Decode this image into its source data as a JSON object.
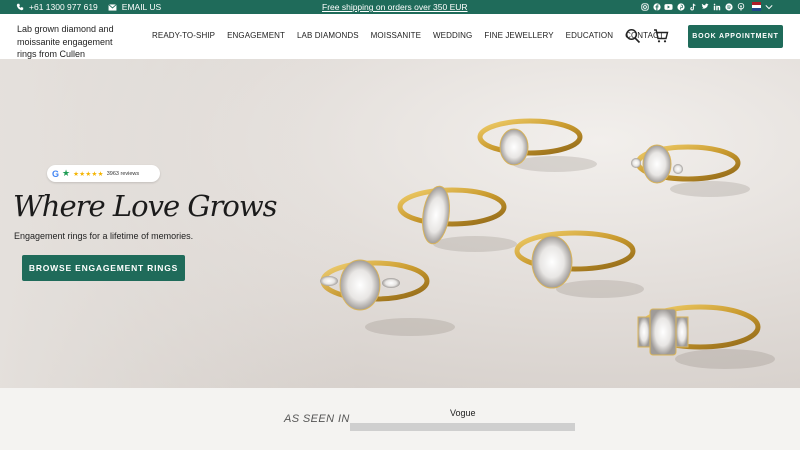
{
  "topbar": {
    "phone": "+61 1300 977 619",
    "email": "EMAIL US",
    "promo": "Free shipping on orders over 350 EUR",
    "social_icons": [
      "instagram-icon",
      "facebook-icon",
      "youtube-icon",
      "pinterest-icon",
      "tiktok-icon",
      "twitter-icon",
      "linkedin-icon",
      "spotify-icon",
      "podcast-icon"
    ],
    "country_flag": "netherlands-flag"
  },
  "header": {
    "brand": "Lab grown diamond and moissanite engagement rings from Cullen Jewellery",
    "nav": [
      "READY-TO-SHIP",
      "ENGAGEMENT",
      "LAB DIAMONDS",
      "MOISSANITE",
      "WEDDING",
      "FINE JEWELLERY",
      "EDUCATION",
      "CONTACT"
    ],
    "book_label": "BOOK APPOINTMENT"
  },
  "hero": {
    "reviews": "3963 reviews",
    "stars": "★★★★★",
    "title": "Where Love Grows",
    "subtitle": "Engagement rings for a lifetime of memories.",
    "cta": "BROWSE ENGAGEMENT RINGS"
  },
  "seen": {
    "label": "AS SEEN IN",
    "publication": "Vogue"
  },
  "colors": {
    "brand_green": "#1f6b5a",
    "gold": "#d4a53a"
  }
}
